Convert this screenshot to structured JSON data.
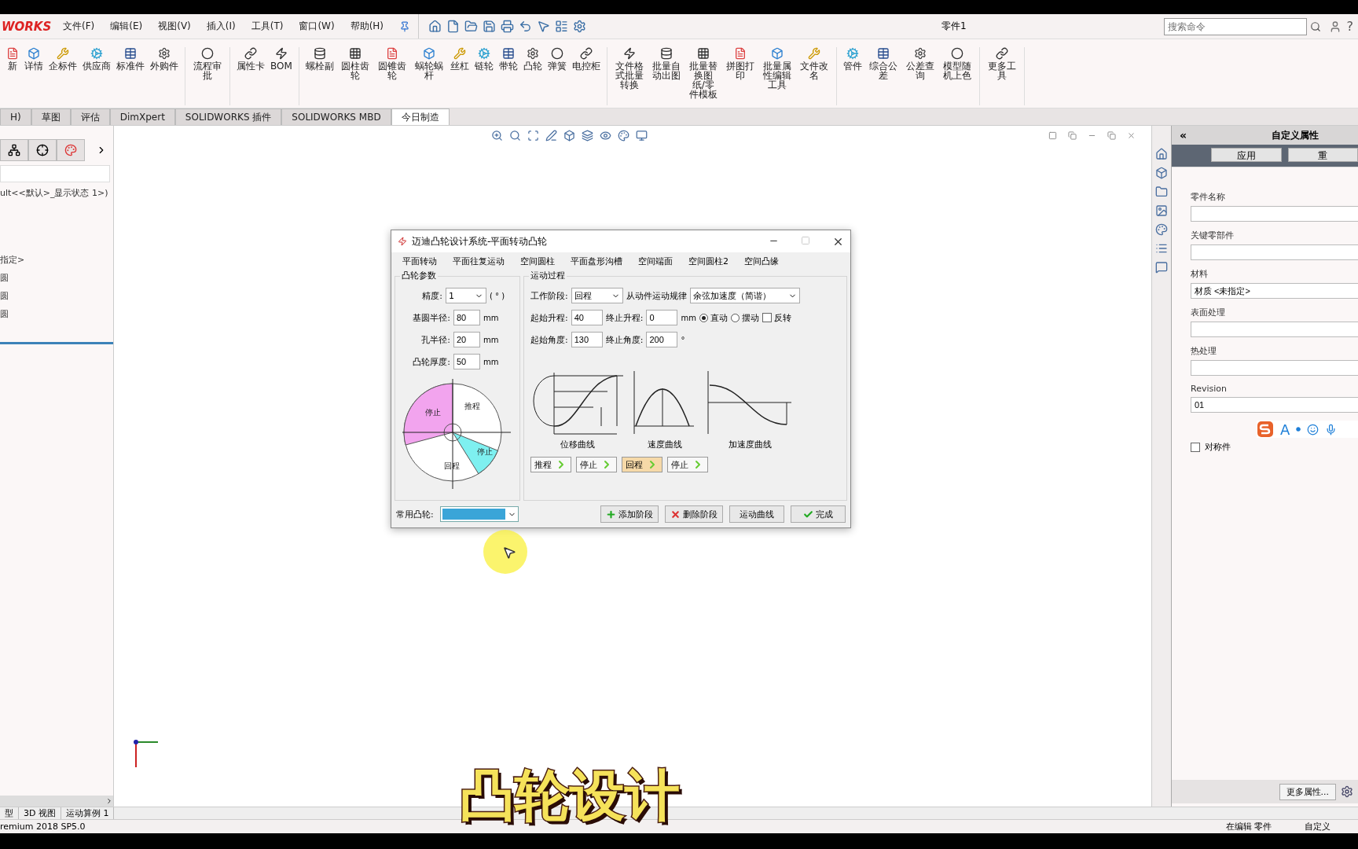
{
  "app": {
    "logo": "WORKS",
    "menus": [
      "文件(F)",
      "编辑(E)",
      "视图(V)",
      "插入(I)",
      "工具(T)",
      "窗口(W)",
      "帮助(H)"
    ],
    "document_title": "零件1",
    "search": {
      "placeholder": "搜索命令"
    },
    "help": "?"
  },
  "ribbon": {
    "groups": [
      [
        "新",
        "详情",
        "企标件",
        "供应商",
        "标准件",
        "外购件"
      ],
      [
        "流程审批"
      ],
      [
        "属性卡",
        "BOM"
      ],
      [
        "螺栓副",
        "圆柱齿轮",
        "圆锥齿轮",
        "蜗轮蜗杆",
        "丝杠",
        "链轮",
        "带轮",
        "凸轮",
        "弹簧",
        "电控柜"
      ],
      [
        "文件格式批量转换",
        "批量自动出图",
        "批量替换图纸/零件模板",
        "拼图打印",
        "批量属性编辑工具",
        "文件改名"
      ],
      [
        "管件",
        "综合公差",
        "公差查询",
        "模型随机上色"
      ],
      [
        "更多工具"
      ]
    ]
  },
  "command_tabs": [
    {
      "label": "H)",
      "selected": false
    },
    {
      "label": "草图",
      "selected": false
    },
    {
      "label": "评估",
      "selected": false
    },
    {
      "label": "DimXpert",
      "selected": false
    },
    {
      "label": "SOLIDWORKS 插件",
      "selected": false
    },
    {
      "label": "SOLIDWORKS MBD",
      "selected": false
    },
    {
      "label": "今日制造",
      "selected": true
    }
  ],
  "feature_tree": {
    "lines": [
      "ult<<默认>_显示状态 1>)",
      "指定>",
      "圆",
      "圆",
      "圆"
    ]
  },
  "dialog": {
    "title": "迈迪凸轮设计系统-平面转动凸轮",
    "menu": [
      "平面转动",
      "平面往复运动",
      "空间圆柱",
      "平面盘形沟槽",
      "空间端面",
      "空间圆柱2",
      "空间凸缘"
    ],
    "cam_params": {
      "title": "凸轮参数",
      "precision": {
        "label": "精度:",
        "value": "1",
        "unit": "( ° )"
      },
      "fields": [
        {
          "label": "基圆半径:",
          "value": "80",
          "unit": "mm"
        },
        {
          "label": "孔半径:",
          "value": "20",
          "unit": "mm"
        },
        {
          "label": "凸轮厚度:",
          "value": "50",
          "unit": "mm"
        }
      ],
      "diagram_labels": [
        "停止",
        "推程",
        "停止",
        "回程"
      ]
    },
    "motion": {
      "title": "运动过程",
      "stage": {
        "label": "工作阶段:",
        "value": "回程"
      },
      "law": {
        "label": "从动件运动规律",
        "value": "余弦加速度（简谐）"
      },
      "rise_start": {
        "label": "起始升程:",
        "value": "40"
      },
      "rise_end": {
        "label": "终止升程:",
        "value": "0",
        "unit": "mm"
      },
      "motion_types": [
        {
          "label": "直动",
          "selected": true
        },
        {
          "label": "摆动",
          "selected": false
        }
      ],
      "reverse": {
        "label": "反转",
        "checked": false
      },
      "angle_start": {
        "label": "起始角度:",
        "value": "130"
      },
      "angle_end": {
        "label": "终止角度:",
        "value": "200",
        "unit": "°"
      },
      "curves": [
        "位移曲线",
        "速度曲线",
        "加速度曲线"
      ],
      "phases": [
        {
          "label": "推程",
          "selected": false
        },
        {
          "label": "停止",
          "selected": false
        },
        {
          "label": "回程",
          "selected": true
        },
        {
          "label": "停止",
          "selected": false
        }
      ]
    },
    "common_cam": {
      "label": "常用凸轮:"
    },
    "buttons": [
      {
        "label": "添加阶段",
        "kind": "add"
      },
      {
        "label": "删除阶段",
        "kind": "delete"
      },
      {
        "label": "运动曲线",
        "kind": "plain"
      },
      {
        "label": "完成",
        "kind": "done"
      }
    ]
  },
  "properties": {
    "collapse": "«",
    "title": "自定义属性",
    "buttons": [
      "应用",
      "重"
    ],
    "fields": [
      {
        "label": "零件名称"
      },
      {
        "label": "关键零部件"
      },
      {
        "label": "材料",
        "value": "材质 <未指定>"
      },
      {
        "label": "表面处理"
      },
      {
        "label": "热处理"
      },
      {
        "label": "Revision",
        "value": "01"
      }
    ],
    "ime_letter": "A",
    "symmetric": {
      "label": "对称件",
      "checked": false
    },
    "more_button": "更多属性..."
  },
  "bottom_tabs": [
    "型",
    "3D 视图",
    "运动算例 1"
  ],
  "status_bar": {
    "version": "remium 2018 SP5.0",
    "mode": "在编辑 零件",
    "units": "自定义"
  },
  "subtitle": "凸轮设计"
}
